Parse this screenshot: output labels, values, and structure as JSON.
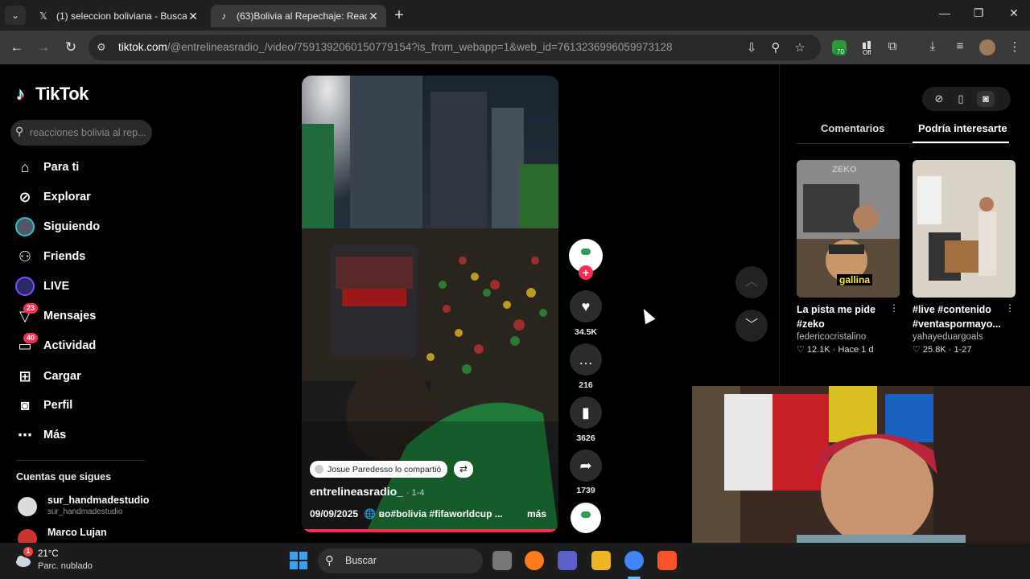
{
  "browser": {
    "tabs": [
      {
        "label": "(1) seleccion boliviana - Buscar",
        "favicon": "x-logo-icon",
        "active": false
      },
      {
        "label": "(63)Bolivia al Repechaje: Reacció",
        "favicon": "tiktok-logo-icon",
        "active": true
      }
    ],
    "url_host": "tiktok.com",
    "url_path": "/@entrelineasradio_/video/7591392060150779154?is_from_webapp=1&web_id=7613236996059973128",
    "extension_badges": {
      "green": "70",
      "off": "Off"
    }
  },
  "tiktok": {
    "logo_text": "TikTok",
    "search_placeholder": "reacciones bolivia al rep...",
    "nav": [
      {
        "label": "Para ti",
        "icon": "home-icon"
      },
      {
        "label": "Explorar",
        "icon": "compass-icon"
      },
      {
        "label": "Siguiendo",
        "icon": "following-avatar-icon"
      },
      {
        "label": "Friends",
        "icon": "friends-icon"
      },
      {
        "label": "LIVE",
        "icon": "live-icon"
      },
      {
        "label": "Mensajes",
        "icon": "messages-icon",
        "badge": "23"
      },
      {
        "label": "Actividad",
        "icon": "activity-icon",
        "badge": "40"
      },
      {
        "label": "Cargar",
        "icon": "upload-icon"
      },
      {
        "label": "Perfil",
        "icon": "profile-icon"
      },
      {
        "label": "Más",
        "icon": "more-icon"
      }
    ],
    "follows_title": "Cuentas que sigues",
    "follows": [
      {
        "name": "sur_handmadestudio",
        "handle": "sur_handmadestudio"
      },
      {
        "name": "Marco Lujan",
        "handle": ""
      }
    ],
    "video": {
      "shared_by": "Josue Paredesso lo compartió",
      "author": "entrelineasradio_",
      "author_meta": "· 1-4",
      "date": "09/09/2025",
      "description": "🌐 ʙᴏ#bolivia #fifaworldcup ...",
      "more_label": "más",
      "progress_fraction": 1.0
    },
    "actions": {
      "likes": "34.5K",
      "comments": "216",
      "saves": "3626",
      "shares": "1739"
    },
    "right_panel": {
      "tabs": [
        "Comentarios",
        "Podría interesarte"
      ],
      "active_tab": "Podría interesarte",
      "cards": [
        {
          "title": "La pista me pide #zeko",
          "author": "federicocristalino",
          "meta": "♡ 12.1K · Hace 1 d",
          "overlay_text": "gallina",
          "watermark": "ZEKO"
        },
        {
          "title": "#live #contenido #ventaspormayo...",
          "author": "yahayeduargoals",
          "meta": "♡ 25.8K · 1-27"
        }
      ]
    }
  },
  "taskbar": {
    "temperature": "21°C",
    "condition": "Parc. nublado",
    "weather_badge": "1",
    "search_label": "Buscar"
  },
  "colors": {
    "accent": "#fe2c55",
    "cyan": "#25f4ee",
    "tab_bg": "#1f1f1f",
    "toolbar_bg": "#3a3a3a"
  }
}
